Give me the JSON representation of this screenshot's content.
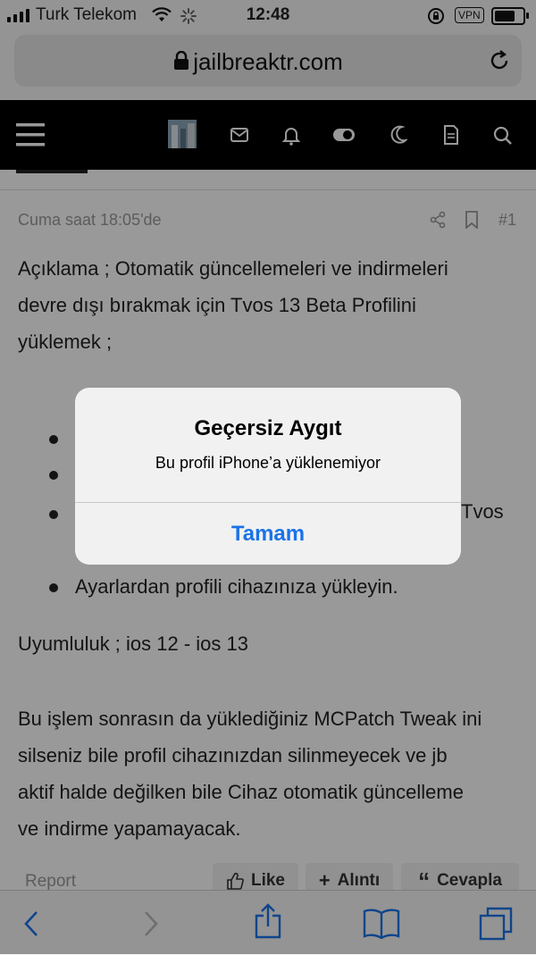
{
  "status_bar": {
    "carrier": "Turk Telekom",
    "time": "12:48",
    "vpn": "VPN"
  },
  "url_bar": {
    "domain": "jailbreaktr.com"
  },
  "nav_icons": [
    "menu-icon",
    "avatar",
    "envelope-icon",
    "bell-icon",
    "toggle-icon",
    "moon-icon",
    "document-icon",
    "search-icon"
  ],
  "post": {
    "timestamp": "Cuma saat 18:05'de",
    "number": "#1",
    "description": [
      "Açıklama ; Otomatik güncellemeleri ve indirmeleri",
      "devre dışı bırakmak için Tvos 13 Beta Profilini",
      "yüklemek ;"
    ],
    "bullet_tail": "Tvos",
    "last_bullet": "Ayarlardan profili cihazınıza yükleyin.",
    "compatibility": "Uyumluluk ; ios 12 - ios 13",
    "note": [
      "Bu işlem sonrasın da yüklediğiniz MCPatch Tweak ini",
      "silseniz bile profil cihazınızdan silinmeyecek ve jb",
      "aktif halde değilken bile Cihaz otomatik güncelleme",
      "ve indirme yapamayacak."
    ]
  },
  "post_footer": {
    "report": "Report",
    "like": "Like",
    "quote": "Alıntı",
    "reply": "Cevapla"
  },
  "alert": {
    "title": "Geçersiz Aygıt",
    "message": "Bu profil iPhone’a yüklenemiyor",
    "button": "Tamam"
  },
  "colors": {
    "accent": "#1a73e8",
    "nav_bg": "#000000"
  }
}
